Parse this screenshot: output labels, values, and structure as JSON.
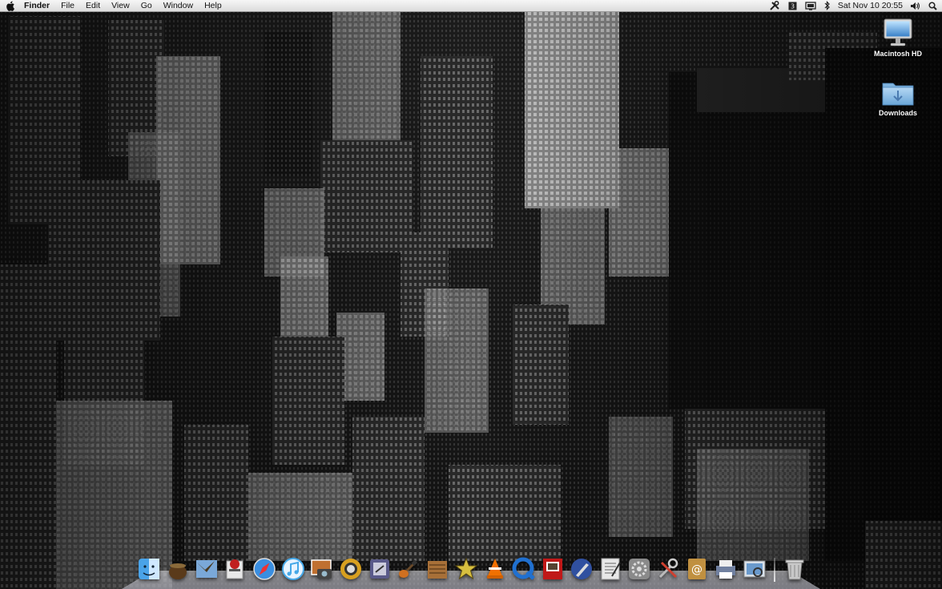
{
  "menubar": {
    "apple_icon": "apple-icon",
    "app_name": "Finder",
    "menus": [
      "File",
      "Edit",
      "View",
      "Go",
      "Window",
      "Help"
    ],
    "status_icons": [
      "tools-icon",
      "spaces-icon",
      "display-icon",
      "bluetooth-icon"
    ],
    "clock": "Sat Nov 10  20:55",
    "volume_icon": "volume-icon",
    "spotlight_icon": "spotlight-icon"
  },
  "desktop": {
    "icons": [
      {
        "label": "Macintosh HD",
        "icon": "hard-drive-icon"
      },
      {
        "label": "Downloads",
        "icon": "folder-icon"
      }
    ]
  },
  "dock": {
    "items": [
      {
        "name": "Finder",
        "icon": "finder-icon",
        "color": "#4aa3e8"
      },
      {
        "name": "Cauldron",
        "icon": "cauldron-icon",
        "color": "#5a3a1a"
      },
      {
        "name": "Mail",
        "icon": "mail-icon",
        "color": "#7aa8d8"
      },
      {
        "name": "Utility",
        "icon": "app-icon",
        "color": "#c02020"
      },
      {
        "name": "Safari",
        "icon": "safari-icon",
        "color": "#3a8ee0"
      },
      {
        "name": "iTunes",
        "icon": "itunes-icon",
        "color": "#46a8e8"
      },
      {
        "name": "iPhoto",
        "icon": "iphoto-icon",
        "color": "#c07030"
      },
      {
        "name": "Magnifier",
        "icon": "magnifier-icon",
        "color": "#d8a020"
      },
      {
        "name": "Script Editor",
        "icon": "script-icon",
        "color": "#5a5a8a"
      },
      {
        "name": "GarageBand",
        "icon": "guitar-icon",
        "color": "#d07020"
      },
      {
        "name": "Notes",
        "icon": "notes-icon",
        "color": "#a87038"
      },
      {
        "name": "Star",
        "icon": "star-icon",
        "color": "#d8c040"
      },
      {
        "name": "VLC",
        "icon": "vlc-icon",
        "color": "#f07000"
      },
      {
        "name": "QuickTime",
        "icon": "quicktime-icon",
        "color": "#2070d0"
      },
      {
        "name": "Photo Booth",
        "icon": "photobooth-icon",
        "color": "#c01818"
      },
      {
        "name": "Pen Tool",
        "icon": "pen-icon",
        "color": "#3050a0"
      },
      {
        "name": "TextEdit",
        "icon": "textedit-icon",
        "color": "#e8e8e8"
      },
      {
        "name": "System Preferences",
        "icon": "system-preferences-icon",
        "color": "#8a8a8a"
      },
      {
        "name": "Utilities",
        "icon": "tools-icon",
        "color": "#d04030"
      },
      {
        "name": "Address Book",
        "icon": "address-book-icon",
        "color": "#c09040"
      },
      {
        "name": "Print Center",
        "icon": "printer-icon",
        "color": "#7080a0"
      },
      {
        "name": "Preview",
        "icon": "preview-icon",
        "color": "#d8e0e8"
      },
      {
        "name": "Trash",
        "icon": "trash-icon",
        "color": "#c8c8c8"
      }
    ]
  }
}
